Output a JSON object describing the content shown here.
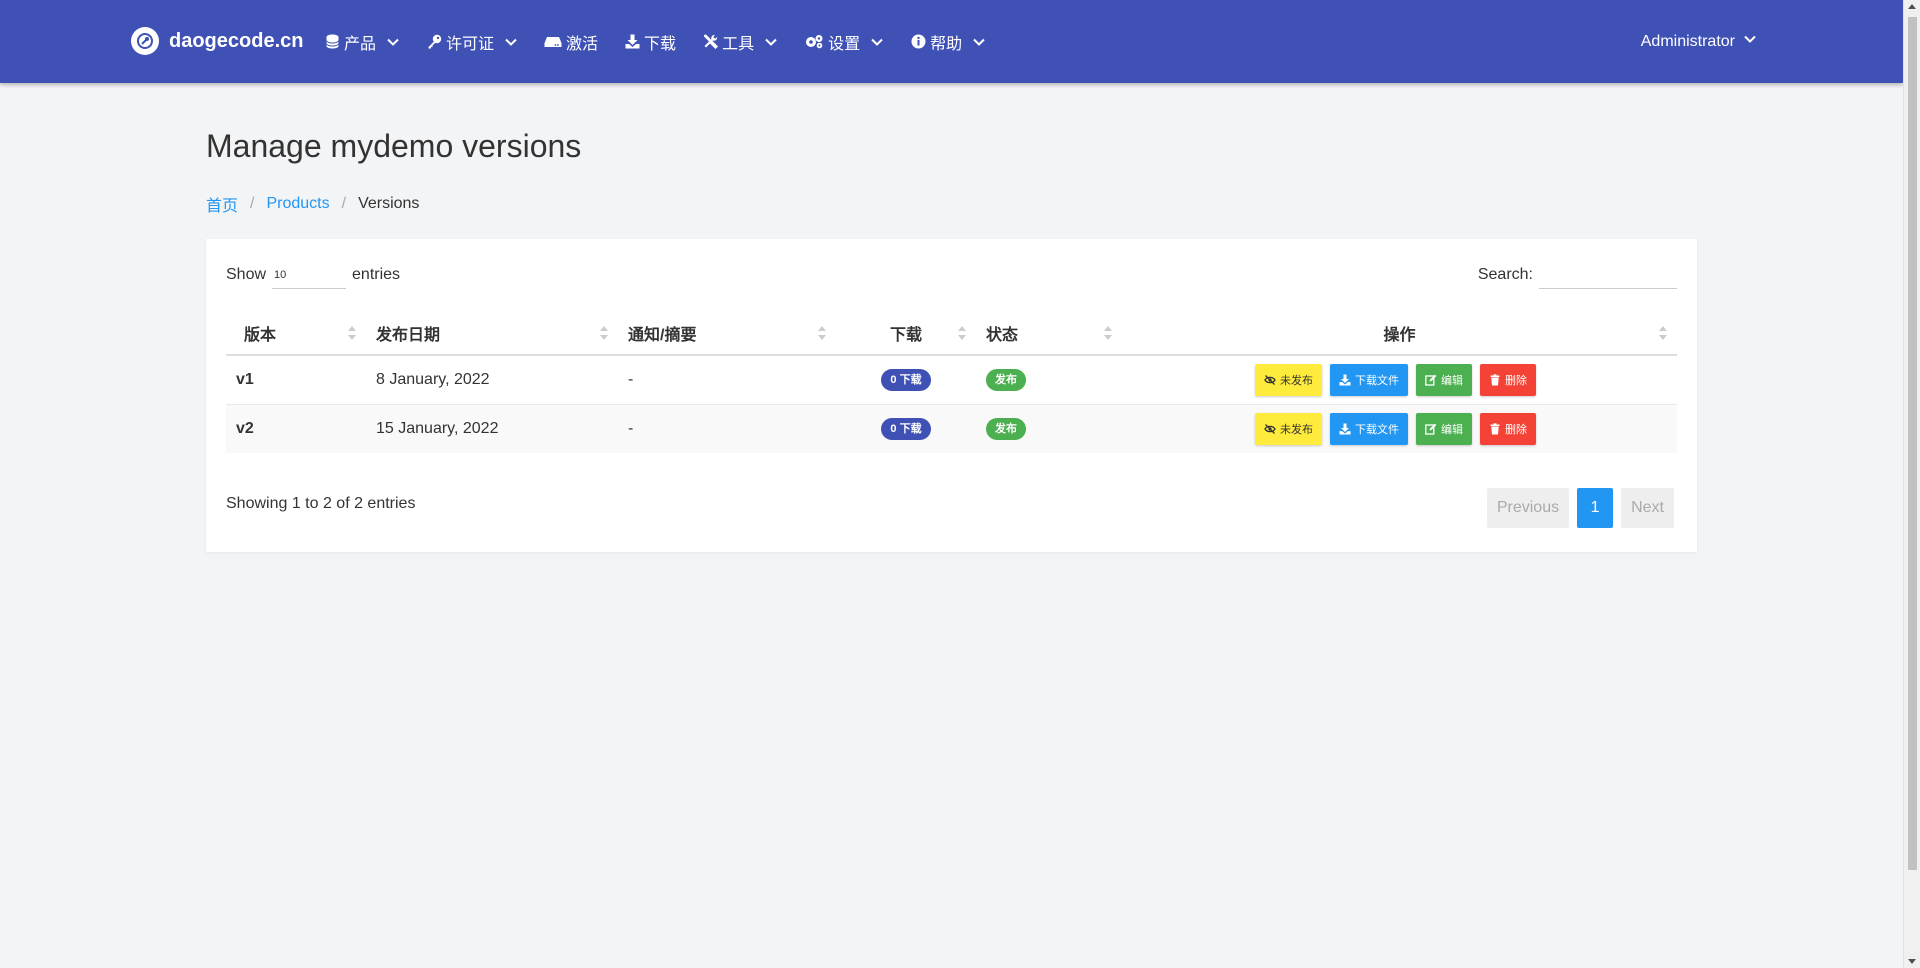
{
  "brand": {
    "name": "daogecode.cn"
  },
  "nav": {
    "items": [
      {
        "label": "产品",
        "icon": "database-icon",
        "dropdown": true
      },
      {
        "label": "许可证",
        "icon": "key-icon",
        "dropdown": true
      },
      {
        "label": "激活",
        "icon": "hdd-icon",
        "dropdown": false
      },
      {
        "label": "下载",
        "icon": "download-icon",
        "dropdown": false
      },
      {
        "label": "工具",
        "icon": "tools-icon",
        "dropdown": true
      },
      {
        "label": "设置",
        "icon": "cogs-icon",
        "dropdown": true
      },
      {
        "label": "帮助",
        "icon": "info-circle-icon",
        "dropdown": true
      }
    ],
    "user": "Administrator"
  },
  "page": {
    "title": "Manage mydemo versions",
    "breadcrumb": {
      "home": "首页",
      "products": "Products",
      "current": "Versions"
    }
  },
  "table_controls": {
    "show_label": "Show",
    "length_value": "10",
    "entries_label": "entries",
    "search_label": "Search:",
    "search_value": ""
  },
  "table": {
    "columns": [
      "版本",
      "发布日期",
      "通知/摘要",
      "下载",
      "状态",
      "操作"
    ],
    "rows": [
      {
        "version": "v1",
        "date": "8 January, 2022",
        "notes": "-",
        "downloads": "0 下载",
        "status": "发布"
      },
      {
        "version": "v2",
        "date": "15 January, 2022",
        "notes": "-",
        "downloads": "0 下载",
        "status": "发布"
      }
    ],
    "actions": {
      "unpublish": "未发布",
      "download_file": "下载文件",
      "edit": "编辑",
      "delete": "删除"
    }
  },
  "footer": {
    "info": "Showing 1 to 2 of 2 entries",
    "previous": "Previous",
    "page": "1",
    "next": "Next"
  },
  "colors": {
    "navbar": "#3f51b5",
    "link": "#2196f3",
    "badge_blue": "#3f51b5",
    "badge_green": "#4caf50",
    "btn_yellow": "#ffeb3b",
    "btn_blue": "#2196f3",
    "btn_green": "#4caf50",
    "btn_red": "#f44336"
  }
}
